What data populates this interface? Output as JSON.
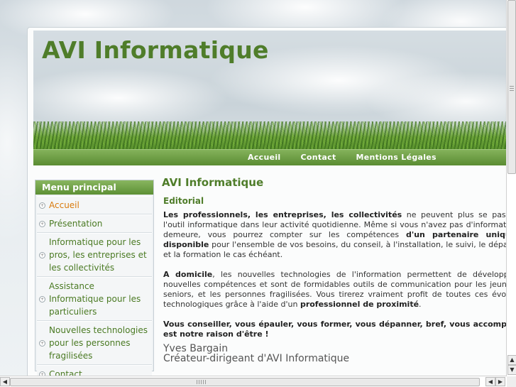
{
  "site": {
    "title": "AVI Informatique"
  },
  "nav": {
    "items": [
      "Accueil",
      "Contact",
      "Mentions Légales"
    ]
  },
  "sidebar": {
    "title": "Menu principal",
    "items": [
      {
        "label": "Accueil",
        "active": true
      },
      {
        "label": "Présentation",
        "active": false
      },
      {
        "label": "Informatique pour les pros, les entreprises et les collectivités",
        "active": false
      },
      {
        "label": "Assistance Informatique pour les particuliers",
        "active": false
      },
      {
        "label": "Nouvelles technologies pour les personnes fragilisées",
        "active": false
      },
      {
        "label": "Contact",
        "active": false
      }
    ]
  },
  "content": {
    "title": "AVI Informatique",
    "editorial": "Editorial",
    "p1": {
      "b1": "Les professionnels, les entreprises, les collectivités",
      "t1": " ne peuvent plus se passer de l'outil informatique dans leur activité quotidienne. Même si vous n'avez pas d'informaticien à demeure, vous pourrez compter sur les compétences ",
      "b2": "d'un partenaire unique et disponible",
      "t2": " pour l'ensemble de vos besoins,  du conseil, à l'installation, le suivi, le dépannage et la formation le cas échéant."
    },
    "p2": {
      "b1": "A domicile",
      "t1": ", les nouvelles technologies de l'information permettent de développer de nouvelles compétences et sont de formidables outils de communication pour les jeunes, les seniors, et les personnes fragilisées. Vous tirerez vraiment profit de toutes ces évolutions technologiques grâce à l'aide d'un ",
      "b2": "professionnel de proximité",
      "t2": "."
    },
    "p3": "Vous conseiller, vous épauler, vous former, vous dépanner, bref, vous accompagner est notre raison d'être !",
    "signature_name": "Yves Bargain",
    "signature_role": "Créateur-dirigeant d'AVI Informatique"
  },
  "colors": {
    "brand_green": "#4f7d2a",
    "active_orange": "#d97a0c",
    "nav_green": "#5a8c32"
  }
}
